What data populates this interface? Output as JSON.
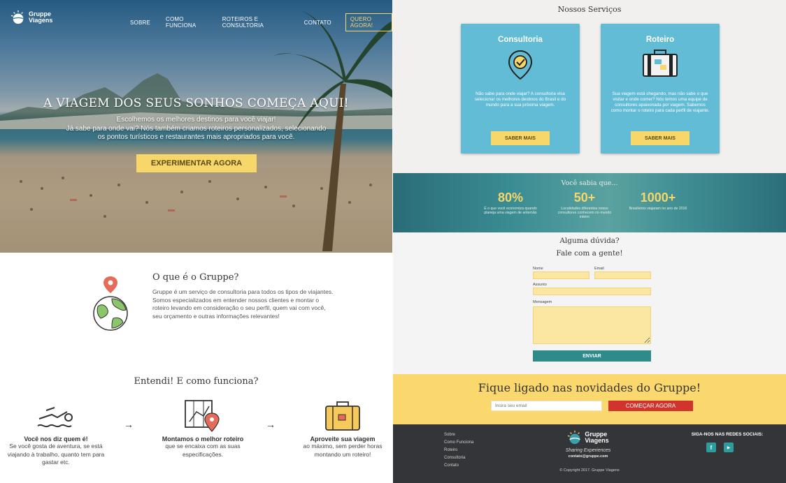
{
  "brand": {
    "name_line1": "Gruppe",
    "name_line2": "Viagens"
  },
  "nav": {
    "items": [
      "SOBRE",
      "COMO FUNCIONA",
      "ROTEIROS E CONSULTORIA",
      "CONTATO"
    ],
    "cta": "QUERO AGORA!"
  },
  "hero": {
    "title": "A VIAGEM DOS SEUS SONHOS COMEÇA AQUI!",
    "subtitle_line1": "Escolhemos os melhores destinos para você viajar!",
    "subtitle_line2": "Já sabe para onde vai? Nós também criamos roteiros personalizados, selecionando",
    "subtitle_line3": "os pontos turísticos e restaurantes mais apropriados para você.",
    "button": "EXPERIMENTAR AGORA"
  },
  "about": {
    "title": "O que é o Gruppe?",
    "text": "Gruppe é um serviço de consultoria para todos os tipos de viajantes. Somos especializados em entender nossos clientes e montar o roteiro levando em consideração o seu perfil, quem vai com você, seu orçamento e outras informações relevantes!"
  },
  "how": {
    "title": "Entendi! E como funciona?",
    "steps": [
      {
        "title": "Você nos diz quem é!",
        "desc": "Se você gosta de aventura, se está viajando à trabalho, quanto tem para gastar etc."
      },
      {
        "title": "Montamos o melhor roteiro",
        "desc": "que se encaixa com as suas especificações."
      },
      {
        "title": "Aproveite sua viagem",
        "desc": "ao máximo, sem perder horas montando um roteiro!"
      }
    ],
    "arrow": "→"
  },
  "services": {
    "title": "Nossos Serviços",
    "cards": [
      {
        "title": "Consultoria",
        "desc": "Não sabe para onde viajar? A consultoria visa selecionar os melhores destinos do Brasil e do mundo para a sua próxima viagem.",
        "button": "SABER MAIS"
      },
      {
        "title": "Roteiro",
        "desc": "Sua viagem está chegando, mas não sabe o que visitar e onde comer? Nós temos uma equipe de consultores apaixonada por viagem. Sabemos como montar o roteiro para cada perfil de viajante.",
        "button": "SABER MAIS"
      }
    ]
  },
  "stats": {
    "title": "Você sabia que...",
    "items": [
      {
        "value": "80%",
        "label": "É o que você economiza quando planeja uma viagem de antemão"
      },
      {
        "value": "50+",
        "label": "Localidades diferentes nosso consultores conhecem no mundo inteiro"
      },
      {
        "value": "1000+",
        "label": "Brasileiros viajaram no ano de 2016"
      }
    ]
  },
  "contact": {
    "title1": "Alguma dúvida?",
    "title2": "Fale com a gente!",
    "name_label": "Nome",
    "email_label": "Email",
    "subject_label": "Assunto",
    "message_label": "Mensagem",
    "send": "ENVIAR"
  },
  "newsletter": {
    "title": "Fique ligado nas novidades do Gruppe!",
    "placeholder": "Insira seu email",
    "button": "COMEÇAR AGORA"
  },
  "footer": {
    "links": [
      "Sobre",
      "Como Funciona",
      "Roteiro",
      "Consultoria",
      "Contato"
    ],
    "tagline": "Sharing Experiences",
    "email": "contato@gruppe.com",
    "copyright": "© Copyright 2017. Gruppe Viagens",
    "social_title": "SIGA-NOS NAS REDES SOCIAIS:",
    "facebook": "f",
    "youtube": "▶"
  },
  "colors": {
    "accent_yellow": "#f7d66a",
    "teal": "#62bcd5",
    "dark_teal": "#2f8a8a",
    "red": "#d0342c",
    "footer": "#333538"
  }
}
